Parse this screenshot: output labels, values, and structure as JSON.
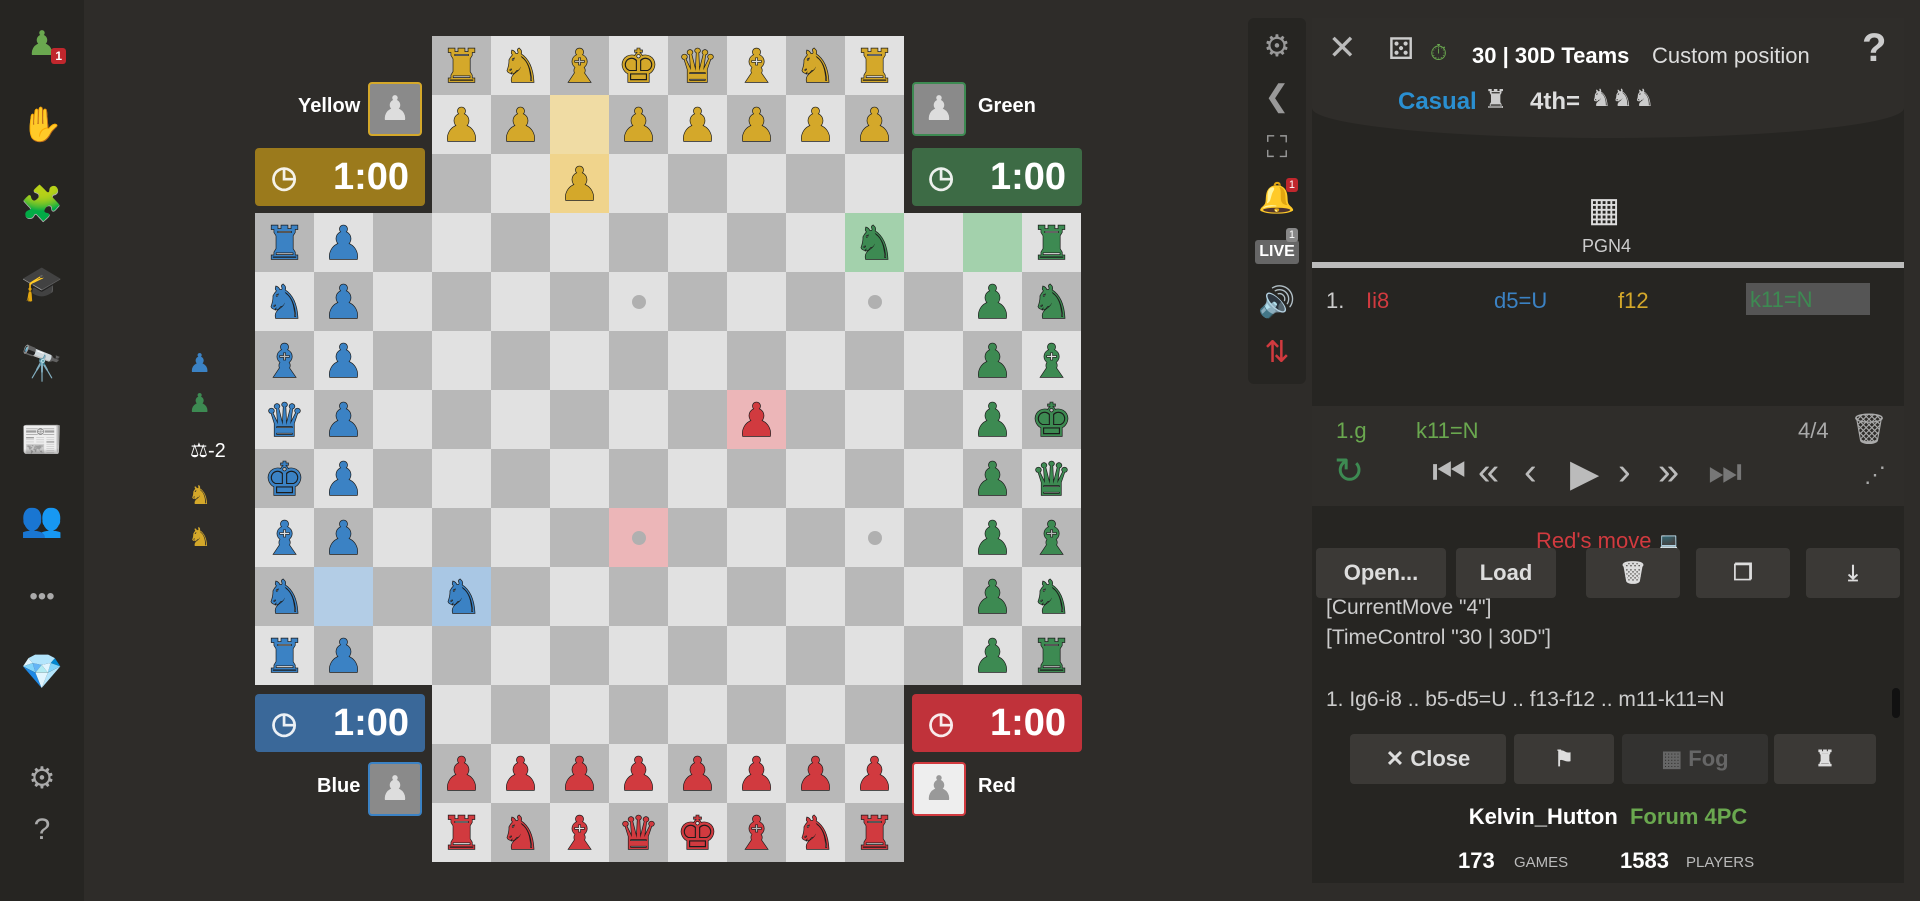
{
  "sidebar": {
    "items": [
      {
        "name": "play",
        "icon": "pawn-icon",
        "glyph": "♟",
        "color": "#6aa84f",
        "badge": "1"
      },
      {
        "name": "computer",
        "icon": "hand-pawn-icon",
        "glyph": "✋",
        "color": "#e0c9a6"
      },
      {
        "name": "puzzles",
        "icon": "puzzle-icon",
        "glyph": "🧩",
        "color": "#e07a3f"
      },
      {
        "name": "learn",
        "icon": "graduation-cap-icon",
        "glyph": "🎓",
        "color": "#3f86c4"
      },
      {
        "name": "watch",
        "icon": "binoculars-icon",
        "glyph": "🔭",
        "color": "#bbb"
      },
      {
        "name": "news",
        "icon": "newspaper-icon",
        "glyph": "📰",
        "color": "#ccc"
      },
      {
        "name": "social",
        "icon": "people-icon",
        "glyph": "👥",
        "color": "#d9a46b"
      },
      {
        "name": "more",
        "icon": "more-dots-icon",
        "glyph": "•••",
        "color": "#aaa"
      },
      {
        "name": "premium",
        "icon": "diamond-icon",
        "glyph": "💎",
        "color": "#3fb6e8"
      },
      {
        "name": "settings",
        "icon": "gear-icon",
        "glyph": "⚙",
        "color": "#aaa"
      },
      {
        "name": "help",
        "icon": "help-icon",
        "glyph": "?",
        "color": "#aaa"
      }
    ]
  },
  "players": {
    "yellow": {
      "name": "Yellow",
      "clock": "1:00",
      "color": "#9b7a1c"
    },
    "green": {
      "name": "Green",
      "clock": "1:00",
      "color": "#3d6b45"
    },
    "blue": {
      "name": "Blue",
      "clock": "1:00",
      "color": "#3a6899"
    },
    "red": {
      "name": "Red",
      "clock": "1:00",
      "color": "#c0323a"
    }
  },
  "side_info": {
    "material_diff": "-2"
  },
  "game_header": {
    "time_control": "30 | 30D Teams",
    "position": "Custom position",
    "mode": "Casual",
    "rank": "4th",
    "rank_suffix": "="
  },
  "tab": {
    "label": "PGN4"
  },
  "moves": [
    {
      "num": "1.",
      "a": "Ii8",
      "b": "d5=U",
      "c": "f12",
      "d": "k11=N"
    }
  ],
  "current": {
    "label": "1.g",
    "move": "k11=N",
    "count": "4/4"
  },
  "status": {
    "text": "Red's move"
  },
  "buttons": {
    "open": "Open...",
    "load": "Load",
    "close": "Close",
    "fog": "Fog"
  },
  "pgn": {
    "line1": "[CurrentMove \"4\"]",
    "line2": "[TimeControl \"30 | 30D\"]",
    "line3": "1. Ig6-i8 .. b5-d5=U .. f13-f12 .. m11-k11=N"
  },
  "footer": {
    "user": "Kelvin_Hutton",
    "forum": "Forum 4PC",
    "games_count": "173",
    "games_label": "GAMES",
    "players_count": "1583",
    "players_label": "PLAYERS"
  },
  "colors": {
    "yellow": "#d4a82a",
    "green": "#3d8a52",
    "blue": "#3b82c4",
    "red": "#d13a3f"
  },
  "board": {
    "pieces": [
      {
        "sq": "d14",
        "p": "r",
        "c": "yellow"
      },
      {
        "sq": "e14",
        "p": "n",
        "c": "yellow"
      },
      {
        "sq": "f14",
        "p": "b",
        "c": "yellow"
      },
      {
        "sq": "g14",
        "p": "k",
        "c": "yellow"
      },
      {
        "sq": "h14",
        "p": "q",
        "c": "yellow"
      },
      {
        "sq": "i14",
        "p": "b",
        "c": "yellow"
      },
      {
        "sq": "j14",
        "p": "n",
        "c": "yellow"
      },
      {
        "sq": "k14",
        "p": "r",
        "c": "yellow"
      },
      {
        "sq": "d13",
        "p": "p",
        "c": "yellow"
      },
      {
        "sq": "e13",
        "p": "p",
        "c": "yellow"
      },
      {
        "sq": "g13",
        "p": "p",
        "c": "yellow"
      },
      {
        "sq": "h13",
        "p": "p",
        "c": "yellow"
      },
      {
        "sq": "i13",
        "p": "p",
        "c": "yellow"
      },
      {
        "sq": "j13",
        "p": "p",
        "c": "yellow"
      },
      {
        "sq": "k13",
        "p": "p",
        "c": "yellow"
      },
      {
        "sq": "f12",
        "p": "p",
        "c": "yellow"
      },
      {
        "sq": "a11",
        "p": "r",
        "c": "blue"
      },
      {
        "sq": "a10",
        "p": "n",
        "c": "blue"
      },
      {
        "sq": "a9",
        "p": "b",
        "c": "blue"
      },
      {
        "sq": "a8",
        "p": "q",
        "c": "blue"
      },
      {
        "sq": "a7",
        "p": "k",
        "c": "blue"
      },
      {
        "sq": "a6",
        "p": "b",
        "c": "blue"
      },
      {
        "sq": "a5",
        "p": "n",
        "c": "blue"
      },
      {
        "sq": "a4",
        "p": "r",
        "c": "blue"
      },
      {
        "sq": "b11",
        "p": "p",
        "c": "blue"
      },
      {
        "sq": "b10",
        "p": "p",
        "c": "blue"
      },
      {
        "sq": "b9",
        "p": "p",
        "c": "blue"
      },
      {
        "sq": "b8",
        "p": "p",
        "c": "blue"
      },
      {
        "sq": "b7",
        "p": "p",
        "c": "blue"
      },
      {
        "sq": "b6",
        "p": "p",
        "c": "blue"
      },
      {
        "sq": "b4",
        "p": "p",
        "c": "blue"
      },
      {
        "sq": "d5",
        "p": "n",
        "c": "blue"
      },
      {
        "sq": "n11",
        "p": "r",
        "c": "green"
      },
      {
        "sq": "n10",
        "p": "n",
        "c": "green"
      },
      {
        "sq": "n9",
        "p": "b",
        "c": "green"
      },
      {
        "sq": "n8",
        "p": "k",
        "c": "green"
      },
      {
        "sq": "n7",
        "p": "q",
        "c": "green"
      },
      {
        "sq": "n6",
        "p": "b",
        "c": "green"
      },
      {
        "sq": "n5",
        "p": "n",
        "c": "green"
      },
      {
        "sq": "n4",
        "p": "r",
        "c": "green"
      },
      {
        "sq": "m10",
        "p": "p",
        "c": "green"
      },
      {
        "sq": "m9",
        "p": "p",
        "c": "green"
      },
      {
        "sq": "m8",
        "p": "p",
        "c": "green"
      },
      {
        "sq": "m7",
        "p": "p",
        "c": "green"
      },
      {
        "sq": "m6",
        "p": "p",
        "c": "green"
      },
      {
        "sq": "m5",
        "p": "p",
        "c": "green"
      },
      {
        "sq": "m4",
        "p": "p",
        "c": "green"
      },
      {
        "sq": "k11",
        "p": "n",
        "c": "green"
      },
      {
        "sq": "d2",
        "p": "p",
        "c": "red"
      },
      {
        "sq": "e2",
        "p": "p",
        "c": "red"
      },
      {
        "sq": "f2",
        "p": "p",
        "c": "red"
      },
      {
        "sq": "g2",
        "p": "p",
        "c": "red"
      },
      {
        "sq": "h2",
        "p": "p",
        "c": "red"
      },
      {
        "sq": "i2",
        "p": "p",
        "c": "red"
      },
      {
        "sq": "j2",
        "p": "p",
        "c": "red"
      },
      {
        "sq": "k2",
        "p": "p",
        "c": "red"
      },
      {
        "sq": "d1",
        "p": "r",
        "c": "red"
      },
      {
        "sq": "e1",
        "p": "n",
        "c": "red"
      },
      {
        "sq": "f1",
        "p": "b",
        "c": "red"
      },
      {
        "sq": "g1",
        "p": "q",
        "c": "red"
      },
      {
        "sq": "h1",
        "p": "k",
        "c": "red"
      },
      {
        "sq": "i1",
        "p": "b",
        "c": "red"
      },
      {
        "sq": "j1",
        "p": "n",
        "c": "red"
      },
      {
        "sq": "k1",
        "p": "r",
        "c": "red"
      },
      {
        "sq": "i8",
        "p": "p",
        "c": "red"
      }
    ],
    "highlights": [
      {
        "sq": "f13",
        "color": "#f0dca4"
      },
      {
        "sq": "f12",
        "color": "#f0d48c"
      },
      {
        "sq": "b5",
        "color": "#b3cde6"
      },
      {
        "sq": "d5",
        "color": "#a9c7e4"
      },
      {
        "sq": "m11",
        "color": "#a3d1ac"
      },
      {
        "sq": "k11",
        "color": "#a3d1ac"
      },
      {
        "sq": "i8",
        "color": "#ecb6b8"
      },
      {
        "sq": "g6",
        "color": "#ecb6b8"
      }
    ],
    "dots": [
      "g10",
      "k10",
      "g6",
      "k6"
    ]
  }
}
